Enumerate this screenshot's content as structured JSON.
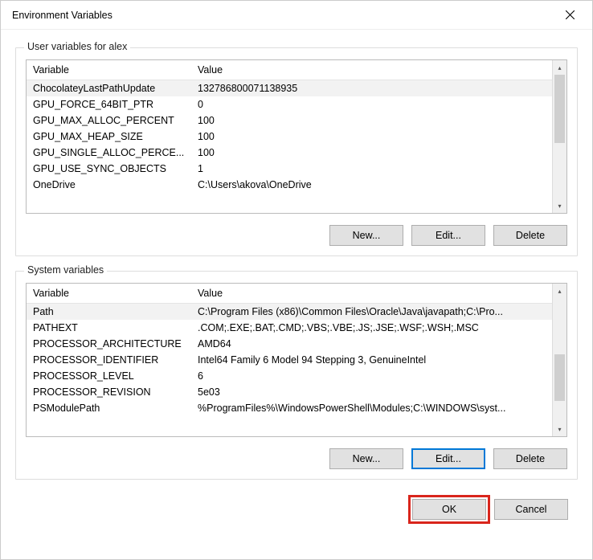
{
  "window": {
    "title": "Environment Variables"
  },
  "userGroup": {
    "label": "User variables for alex",
    "headers": {
      "variable": "Variable",
      "value": "Value"
    },
    "rows": [
      {
        "variable": "ChocolateyLastPathUpdate",
        "value": "132786800071138935"
      },
      {
        "variable": "GPU_FORCE_64BIT_PTR",
        "value": "0"
      },
      {
        "variable": "GPU_MAX_ALLOC_PERCENT",
        "value": "100"
      },
      {
        "variable": "GPU_MAX_HEAP_SIZE",
        "value": "100"
      },
      {
        "variable": "GPU_SINGLE_ALLOC_PERCE...",
        "value": "100"
      },
      {
        "variable": "GPU_USE_SYNC_OBJECTS",
        "value": "1"
      },
      {
        "variable": "OneDrive",
        "value": "C:\\Users\\akova\\OneDrive"
      }
    ],
    "buttons": {
      "new": "New...",
      "edit": "Edit...",
      "delete": "Delete"
    }
  },
  "systemGroup": {
    "label": "System variables",
    "headers": {
      "variable": "Variable",
      "value": "Value"
    },
    "rows": [
      {
        "variable": "Path",
        "value": "C:\\Program Files (x86)\\Common Files\\Oracle\\Java\\javapath;C:\\Pro..."
      },
      {
        "variable": "PATHEXT",
        "value": ".COM;.EXE;.BAT;.CMD;.VBS;.VBE;.JS;.JSE;.WSF;.WSH;.MSC"
      },
      {
        "variable": "PROCESSOR_ARCHITECTURE",
        "value": "AMD64"
      },
      {
        "variable": "PROCESSOR_IDENTIFIER",
        "value": "Intel64 Family 6 Model 94 Stepping 3, GenuineIntel"
      },
      {
        "variable": "PROCESSOR_LEVEL",
        "value": "6"
      },
      {
        "variable": "PROCESSOR_REVISION",
        "value": "5e03"
      },
      {
        "variable": "PSModulePath",
        "value": "%ProgramFiles%\\WindowsPowerShell\\Modules;C:\\WINDOWS\\syst..."
      }
    ],
    "buttons": {
      "new": "New...",
      "edit": "Edit...",
      "delete": "Delete"
    }
  },
  "dialogButtons": {
    "ok": "OK",
    "cancel": "Cancel"
  }
}
